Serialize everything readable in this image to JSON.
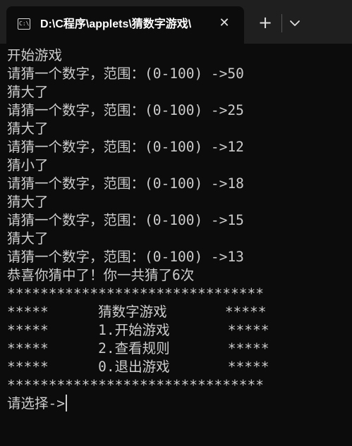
{
  "window": {
    "tab_title": "D:\\C程序\\applets\\猜数字游戏\\",
    "tab_icon": "command-prompt-icon",
    "close_icon": "close-icon",
    "new_tab_icon": "plus-icon",
    "dropdown_icon": "chevron-down-icon"
  },
  "console": {
    "lines": [
      "开始游戏",
      "请猜一个数字，范围：(0-100) ->50",
      "猜大了",
      "请猜一个数字，范围：(0-100) ->25",
      "猜大了",
      "请猜一个数字，范围：(0-100) ->12",
      "猜小了",
      "请猜一个数字，范围：(0-100) ->18",
      "猜大了",
      "请猜一个数字，范围：(0-100) ->15",
      "猜大了",
      "请猜一个数字，范围：(0-100) ->13",
      "恭喜你猜中了！你一共猜了6次",
      "*******************************",
      "*****      猜数字游戏       *****",
      "*****      1.开始游戏       *****",
      "*****      2.查看规则       *****",
      "*****      0.退出游戏       *****",
      "*******************************"
    ],
    "prompt": "请选择->"
  },
  "colors": {
    "background": "#0c0c0c",
    "titlebar": "#1f1f1f",
    "text": "#cccccc"
  }
}
